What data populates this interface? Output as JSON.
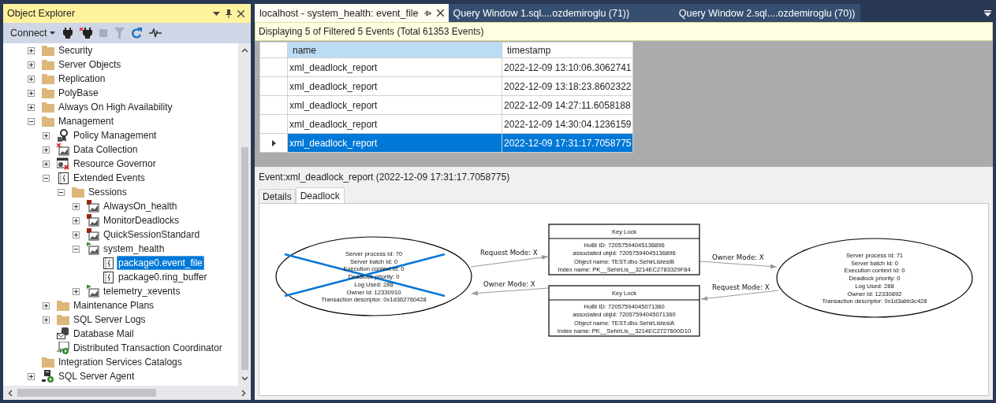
{
  "object_explorer": {
    "title": "Object Explorer",
    "connect": "Connect",
    "tree": [
      {
        "label": "Security",
        "kind": "folder",
        "expanded": false,
        "selected": false
      },
      {
        "label": "Server Objects",
        "kind": "folder",
        "expanded": false,
        "selected": false
      },
      {
        "label": "Replication",
        "kind": "folder",
        "expanded": false,
        "selected": false
      },
      {
        "label": "PolyBase",
        "kind": "folder",
        "expanded": false,
        "selected": false
      },
      {
        "label": "Always On High Availability",
        "kind": "folder",
        "expanded": false,
        "selected": false
      },
      {
        "label": "Management",
        "kind": "folder",
        "expanded": true,
        "selected": false,
        "children": [
          {
            "label": "Policy Management",
            "kind": "policy",
            "expanded": false,
            "selected": false
          },
          {
            "label": "Data Collection",
            "kind": "data-collection",
            "expanded": false,
            "selected": false
          },
          {
            "label": "Resource Governor",
            "kind": "resource-governor",
            "expanded": false,
            "selected": false
          },
          {
            "label": "Extended Events",
            "kind": "xevents",
            "expanded": true,
            "selected": false,
            "children": [
              {
                "label": "Sessions",
                "kind": "folder",
                "expanded": true,
                "selected": false,
                "children": [
                  {
                    "label": "AlwaysOn_health",
                    "kind": "session",
                    "running": false,
                    "expanded": false,
                    "selected": false
                  },
                  {
                    "label": "MonitorDeadlocks",
                    "kind": "session",
                    "running": false,
                    "expanded": false,
                    "selected": false
                  },
                  {
                    "label": "QuickSessionStandard",
                    "kind": "session",
                    "running": false,
                    "expanded": false,
                    "selected": false
                  },
                  {
                    "label": "system_health",
                    "kind": "session",
                    "running": true,
                    "expanded": true,
                    "selected": false,
                    "children": [
                      {
                        "label": "package0.event_file",
                        "kind": "target",
                        "selected": true
                      },
                      {
                        "label": "package0.ring_buffer",
                        "kind": "target",
                        "selected": false
                      }
                    ]
                  },
                  {
                    "label": "telemetry_xevents",
                    "kind": "session",
                    "running": true,
                    "expanded": false,
                    "selected": false
                  }
                ]
              }
            ]
          },
          {
            "label": "Maintenance Plans",
            "kind": "folder",
            "expanded": false,
            "selected": false
          },
          {
            "label": "SQL Server Logs",
            "kind": "folder",
            "expanded": false,
            "selected": false
          },
          {
            "label": "Database Mail",
            "kind": "mail",
            "selected": false
          },
          {
            "label": "Distributed Transaction Coordinator",
            "kind": "dtc",
            "selected": false
          }
        ]
      },
      {
        "label": "Integration Services Catalogs",
        "kind": "folder",
        "selected": false
      },
      {
        "label": "SQL Server Agent",
        "kind": "agent",
        "expanded": false,
        "selected": false
      }
    ]
  },
  "tabs": [
    {
      "label": "localhost - system_health: event_file",
      "selected": true
    },
    {
      "label": "Query Window 1.sql....ozdemiroglu (71))",
      "selected": false
    },
    {
      "label": "Query Window 2.sql....ozdemiroglu (70))",
      "selected": false
    }
  ],
  "info_bar": "Displaying 5 of Filtered 5 Events (Total 61353 Events)",
  "events_table": {
    "columns": [
      {
        "label": "name",
        "highlighted": true
      },
      {
        "label": "timestamp",
        "highlighted": false
      }
    ],
    "rows": [
      {
        "name": "xml_deadlock_report",
        "timestamp": "2022-12-09 13:10:06.3062741",
        "selected": false
      },
      {
        "name": "xml_deadlock_report",
        "timestamp": "2022-12-09 13:18:23.8602322",
        "selected": false
      },
      {
        "name": "xml_deadlock_report",
        "timestamp": "2022-12-09 14:27:11.6058188",
        "selected": false
      },
      {
        "name": "xml_deadlock_report",
        "timestamp": "2022-12-09 14:30:04.1236159",
        "selected": false
      },
      {
        "name": "xml_deadlock_report",
        "timestamp": "2022-12-09 17:31:17.7058775",
        "selected": true
      }
    ]
  },
  "event_title": "Event:xml_deadlock_report (2022-12-09 17:31:17.7058775)",
  "detail_tabs": [
    {
      "label": "Details",
      "selected": false
    },
    {
      "label": "Deadlock",
      "selected": true
    }
  ],
  "deadlock_graph": {
    "processes": [
      {
        "victim": true,
        "lines": [
          "Server process Id: 70",
          "Server batch Id: 0",
          "Execution context Id: 0",
          "Deadlock priority: 0",
          "Log Used: 288",
          "Owner Id: 12330910",
          "Transaction descriptor: 0x1d362760428"
        ]
      },
      {
        "victim": false,
        "lines": [
          "Server process Id: 71",
          "Server batch Id: 0",
          "Execution context Id: 0",
          "Deadlock priority: 0",
          "Log Used: 288",
          "Owner Id: 12330892",
          "Transaction descriptor: 0x1d3abb3c428"
        ]
      }
    ],
    "locks": [
      {
        "title": "Key Lock",
        "lines": [
          "HoBt ID: 72057594045136896",
          "associated objid: 72057594045136896",
          "Object name: TEST.dbo.SehirListesiB",
          "Index name: PK__SehirLis__3214EC2783329F84"
        ]
      },
      {
        "title": "Key Lock",
        "lines": [
          "HoBt ID: 72057594045071360",
          "associated objid: 72057594045071360",
          "Object name: TEST.dbo.SehirListesiA",
          "Index name: PK__SehirLis__3214EC2727600D10"
        ]
      }
    ],
    "edges": [
      {
        "label": "Request Mode: X"
      },
      {
        "label": "Owner Mode: X"
      },
      {
        "label": "Owner Mode: X"
      },
      {
        "label": "Request Mode: X"
      }
    ]
  }
}
